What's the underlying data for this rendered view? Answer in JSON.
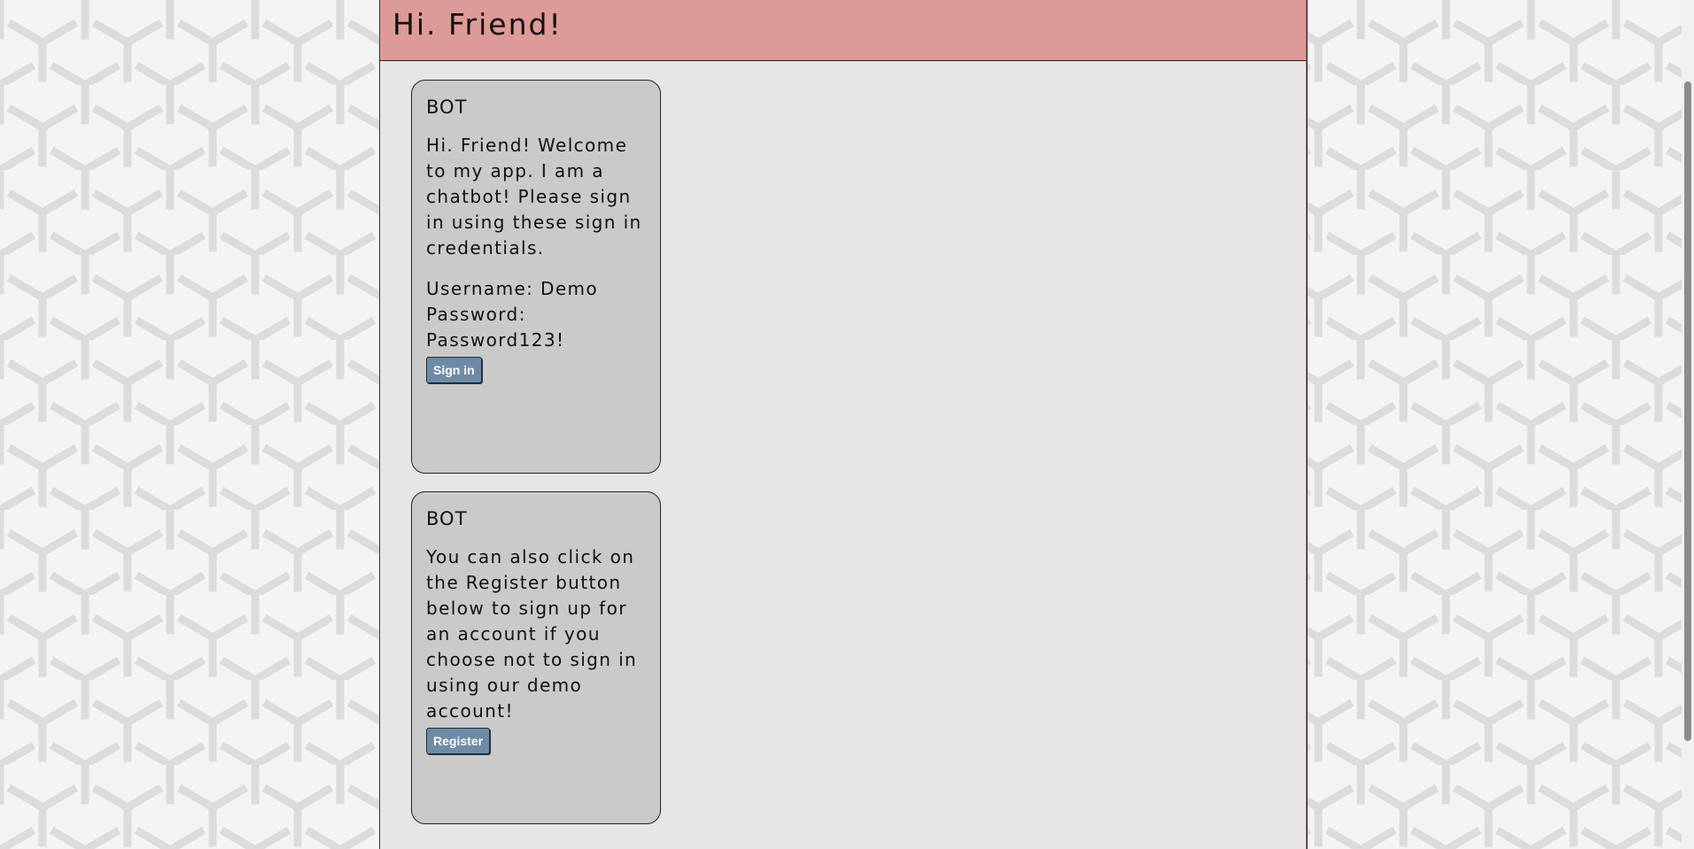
{
  "header": {
    "title": "Hi. Friend!"
  },
  "messages": [
    {
      "sender": "BOT",
      "paragraphs": [
        "Hi. Friend! Welcome to my app. I am a chatbot! Please sign in using these sign in credentials.",
        "Username: Demo Password: Password123!"
      ],
      "button_label": "Sign in"
    },
    {
      "sender": "BOT",
      "paragraphs": [
        "You can also click on the Register button below to sign up for an account if you choose not to sign in using our demo account!"
      ],
      "button_label": "Register"
    }
  ],
  "colors": {
    "header_bg": "#dd9b97",
    "panel_bg": "#e8e6e4",
    "card_bg": "#cacaca",
    "button_bg": "#6f8aa6"
  }
}
